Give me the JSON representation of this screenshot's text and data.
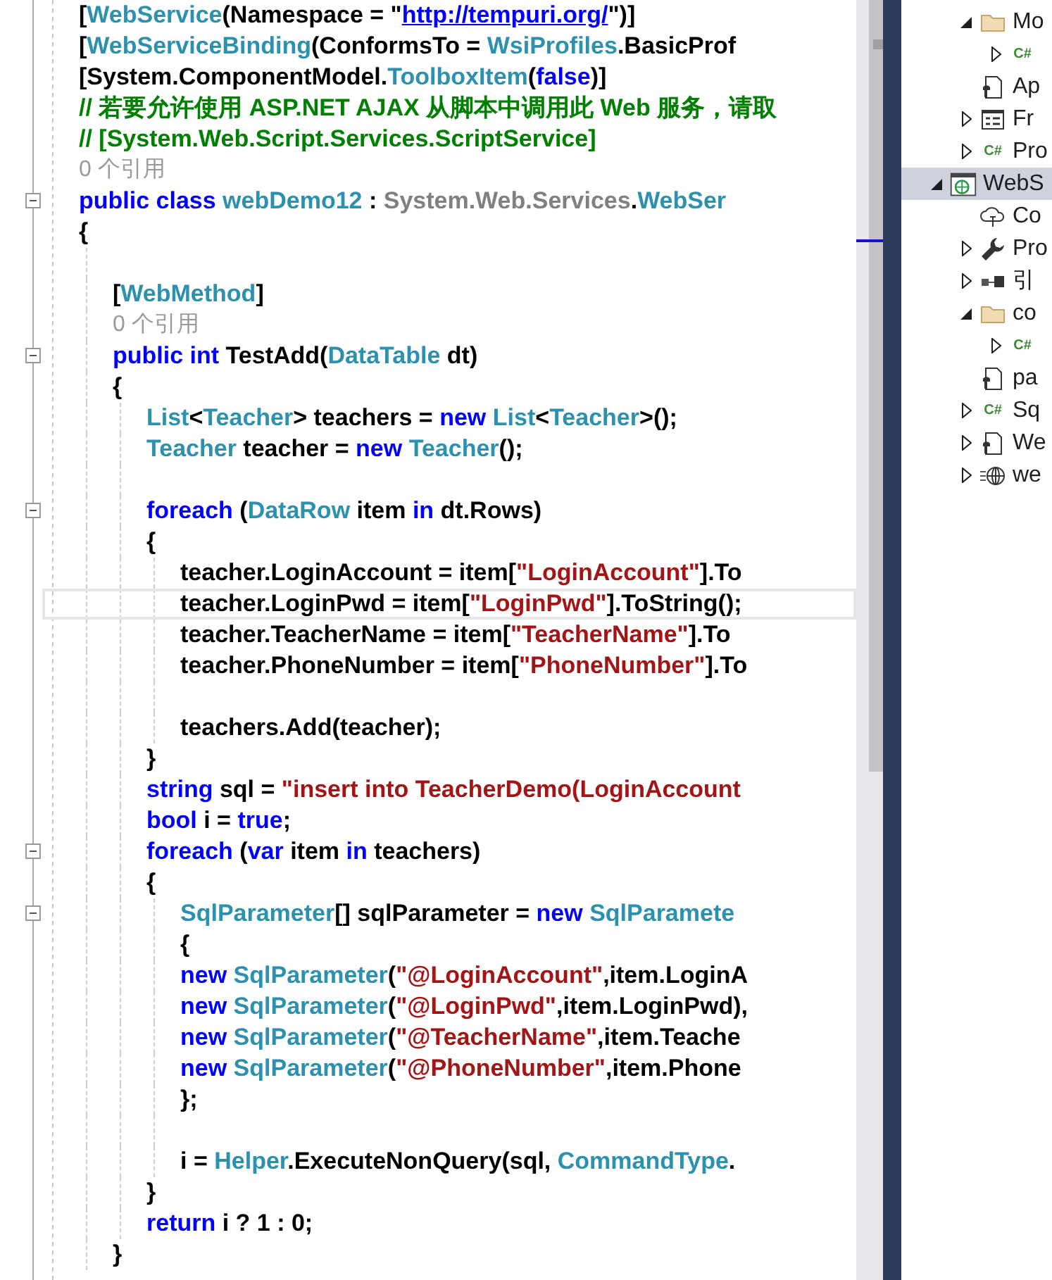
{
  "editor": {
    "lines": [
      {
        "kind": "code",
        "tokens": [
          {
            "kind": "plain",
            "text": "["
          },
          {
            "kind": "type",
            "text": "WebService"
          },
          {
            "kind": "plain",
            "text": "(Namespace = \""
          },
          {
            "kind": "link",
            "text": "http://tempuri.org/"
          },
          {
            "kind": "plain",
            "text": "\")]"
          }
        ]
      },
      {
        "kind": "code",
        "tokens": [
          {
            "kind": "plain",
            "text": "["
          },
          {
            "kind": "type",
            "text": "WebServiceBinding"
          },
          {
            "kind": "plain",
            "text": "(ConformsTo = "
          },
          {
            "kind": "type",
            "text": "WsiProfiles"
          },
          {
            "kind": "plain",
            "text": ".BasicProf"
          }
        ]
      },
      {
        "kind": "code",
        "tokens": [
          {
            "kind": "plain",
            "text": "[System.ComponentModel."
          },
          {
            "kind": "type",
            "text": "ToolboxItem"
          },
          {
            "kind": "plain",
            "text": "("
          },
          {
            "kind": "keyword",
            "text": "false"
          },
          {
            "kind": "plain",
            "text": ")]"
          }
        ]
      },
      {
        "kind": "code",
        "tokens": [
          {
            "kind": "comment",
            "text": "// 若要允许使用 ASP.NET AJAX 从脚本中调用此 Web 服务，请取"
          }
        ]
      },
      {
        "kind": "code",
        "tokens": [
          {
            "kind": "comment",
            "text": "// [System.Web.Script.Services.ScriptService]"
          }
        ]
      },
      {
        "kind": "codelens",
        "text": "0 个引用"
      },
      {
        "kind": "code",
        "expanded": true,
        "tokens": [
          {
            "kind": "keyword",
            "text": "public class "
          },
          {
            "kind": "type",
            "text": "webDemo12"
          },
          {
            "kind": "plain",
            "text": " : "
          },
          {
            "kind": "muted",
            "text": "System.Web.Services"
          },
          {
            "kind": "plain",
            "text": "."
          },
          {
            "kind": "type",
            "text": "WebSer"
          }
        ]
      },
      {
        "kind": "code",
        "tokens": [
          {
            "kind": "plain",
            "text": "{"
          }
        ]
      },
      {
        "children": [
          {
            "kind": "blank"
          },
          {
            "kind": "code",
            "tokens": [
              {
                "kind": "plain",
                "text": "["
              },
              {
                "kind": "type",
                "text": "WebMethod"
              },
              {
                "kind": "plain",
                "text": "]"
              }
            ]
          },
          {
            "kind": "codelens",
            "text": "0 个引用"
          },
          {
            "kind": "code",
            "expanded": true,
            "tokens": [
              {
                "kind": "keyword",
                "text": "public int "
              },
              {
                "kind": "plain",
                "text": "TestAdd("
              },
              {
                "kind": "type",
                "text": "DataTable"
              },
              {
                "kind": "plain",
                "text": " dt)"
              }
            ]
          },
          {
            "kind": "code",
            "tokens": [
              {
                "kind": "plain",
                "text": "{"
              }
            ]
          },
          {
            "children": [
              {
                "kind": "code",
                "tokens": [
                  {
                    "kind": "type",
                    "text": "List"
                  },
                  {
                    "kind": "plain",
                    "text": "<"
                  },
                  {
                    "kind": "type",
                    "text": "Teacher"
                  },
                  {
                    "kind": "plain",
                    "text": "> teachers = "
                  },
                  {
                    "kind": "keyword",
                    "text": "new "
                  },
                  {
                    "kind": "type",
                    "text": "List"
                  },
                  {
                    "kind": "plain",
                    "text": "<"
                  },
                  {
                    "kind": "type",
                    "text": "Teacher"
                  },
                  {
                    "kind": "plain",
                    "text": ">();"
                  }
                ]
              },
              {
                "kind": "code",
                "tokens": [
                  {
                    "kind": "type",
                    "text": "Teacher"
                  },
                  {
                    "kind": "plain",
                    "text": " teacher = "
                  },
                  {
                    "kind": "keyword",
                    "text": "new "
                  },
                  {
                    "kind": "type",
                    "text": "Teacher"
                  },
                  {
                    "kind": "plain",
                    "text": "();"
                  }
                ]
              },
              {
                "kind": "blank"
              },
              {
                "kind": "code",
                "expanded": true,
                "tokens": [
                  {
                    "kind": "keyword",
                    "text": "foreach"
                  },
                  {
                    "kind": "plain",
                    "text": " ("
                  },
                  {
                    "kind": "type",
                    "text": "DataRow"
                  },
                  {
                    "kind": "plain",
                    "text": " item "
                  },
                  {
                    "kind": "keyword",
                    "text": "in"
                  },
                  {
                    "kind": "plain",
                    "text": " dt.Rows)"
                  }
                ]
              },
              {
                "kind": "code",
                "tokens": [
                  {
                    "kind": "plain",
                    "text": "{"
                  }
                ]
              },
              {
                "children": [
                  {
                    "kind": "code",
                    "tokens": [
                      {
                        "kind": "plain",
                        "text": "teacher.LoginAccount = item["
                      },
                      {
                        "kind": "string",
                        "text": "\"LoginAccount\""
                      },
                      {
                        "kind": "plain",
                        "text": "].To"
                      }
                    ]
                  },
                  {
                    "kind": "code",
                    "current": true,
                    "tokens": [
                      {
                        "kind": "plain",
                        "text": "teacher.LoginPwd = item["
                      },
                      {
                        "kind": "string",
                        "text": "\"LoginPwd\""
                      },
                      {
                        "kind": "plain",
                        "text": "].ToString();"
                      }
                    ]
                  },
                  {
                    "kind": "code",
                    "tokens": [
                      {
                        "kind": "plain",
                        "text": "teacher.TeacherName = item["
                      },
                      {
                        "kind": "string",
                        "text": "\"TeacherName\""
                      },
                      {
                        "kind": "plain",
                        "text": "].To"
                      }
                    ]
                  },
                  {
                    "kind": "code",
                    "tokens": [
                      {
                        "kind": "plain",
                        "text": "teacher.PhoneNumber = item["
                      },
                      {
                        "kind": "string",
                        "text": "\"PhoneNumber\""
                      },
                      {
                        "kind": "plain",
                        "text": "].To"
                      }
                    ]
                  },
                  {
                    "kind": "blank"
                  },
                  {
                    "kind": "code",
                    "tokens": [
                      {
                        "kind": "plain",
                        "text": "teachers.Add(teacher);"
                      }
                    ]
                  }
                ]
              },
              {
                "kind": "code",
                "tokens": [
                  {
                    "kind": "plain",
                    "text": "}"
                  }
                ]
              },
              {
                "kind": "code",
                "tokens": [
                  {
                    "kind": "keyword",
                    "text": "string"
                  },
                  {
                    "kind": "plain",
                    "text": " sql = "
                  },
                  {
                    "kind": "string",
                    "text": "\"insert into TeacherDemo(LoginAccount"
                  }
                ]
              },
              {
                "kind": "code",
                "tokens": [
                  {
                    "kind": "keyword",
                    "text": "bool"
                  },
                  {
                    "kind": "plain",
                    "text": " i = "
                  },
                  {
                    "kind": "keyword",
                    "text": "true"
                  },
                  {
                    "kind": "plain",
                    "text": ";"
                  }
                ]
              },
              {
                "kind": "code",
                "expanded": true,
                "tokens": [
                  {
                    "kind": "keyword",
                    "text": "foreach"
                  },
                  {
                    "kind": "plain",
                    "text": " ("
                  },
                  {
                    "kind": "keyword",
                    "text": "var"
                  },
                  {
                    "kind": "plain",
                    "text": " item "
                  },
                  {
                    "kind": "keyword",
                    "text": "in"
                  },
                  {
                    "kind": "plain",
                    "text": " teachers)"
                  }
                ]
              },
              {
                "kind": "code",
                "tokens": [
                  {
                    "kind": "plain",
                    "text": "{"
                  }
                ]
              },
              {
                "children": [
                  {
                    "kind": "code",
                    "expanded": true,
                    "tokens": [
                      {
                        "kind": "type",
                        "text": "SqlParameter"
                      },
                      {
                        "kind": "plain",
                        "text": "[] sqlParameter = "
                      },
                      {
                        "kind": "keyword",
                        "text": "new "
                      },
                      {
                        "kind": "type",
                        "text": "SqlParamete"
                      }
                    ]
                  },
                  {
                    "kind": "code",
                    "tokens": [
                      {
                        "kind": "plain",
                        "text": "{"
                      }
                    ]
                  },
                  {
                    "kind": "code",
                    "tokens": [
                      {
                        "kind": "keyword",
                        "text": "new "
                      },
                      {
                        "kind": "type",
                        "text": "SqlParameter"
                      },
                      {
                        "kind": "plain",
                        "text": "("
                      },
                      {
                        "kind": "string",
                        "text": "\"@LoginAccount\""
                      },
                      {
                        "kind": "plain",
                        "text": ",item.LoginA"
                      }
                    ]
                  },
                  {
                    "kind": "code",
                    "tokens": [
                      {
                        "kind": "keyword",
                        "text": "new "
                      },
                      {
                        "kind": "type",
                        "text": "SqlParameter"
                      },
                      {
                        "kind": "plain",
                        "text": "("
                      },
                      {
                        "kind": "string",
                        "text": "\"@LoginPwd\""
                      },
                      {
                        "kind": "plain",
                        "text": ",item.LoginPwd),"
                      }
                    ]
                  },
                  {
                    "kind": "code",
                    "tokens": [
                      {
                        "kind": "keyword",
                        "text": "new "
                      },
                      {
                        "kind": "type",
                        "text": "SqlParameter"
                      },
                      {
                        "kind": "plain",
                        "text": "("
                      },
                      {
                        "kind": "string",
                        "text": "\"@TeacherName\""
                      },
                      {
                        "kind": "plain",
                        "text": ",item.Teache"
                      }
                    ]
                  },
                  {
                    "kind": "code",
                    "tokens": [
                      {
                        "kind": "keyword",
                        "text": "new "
                      },
                      {
                        "kind": "type",
                        "text": "SqlParameter"
                      },
                      {
                        "kind": "plain",
                        "text": "("
                      },
                      {
                        "kind": "string",
                        "text": "\"@PhoneNumber\""
                      },
                      {
                        "kind": "plain",
                        "text": ",item.Phone"
                      }
                    ]
                  },
                  {
                    "kind": "code",
                    "tokens": [
                      {
                        "kind": "plain",
                        "text": "};"
                      }
                    ]
                  },
                  {
                    "kind": "blank"
                  },
                  {
                    "kind": "code",
                    "tokens": [
                      {
                        "kind": "plain",
                        "text": "i = "
                      },
                      {
                        "kind": "type",
                        "text": "Helper"
                      },
                      {
                        "kind": "plain",
                        "text": ".ExecuteNonQuery(sql, "
                      },
                      {
                        "kind": "type",
                        "text": "CommandType"
                      },
                      {
                        "kind": "plain",
                        "text": "."
                      }
                    ]
                  }
                ]
              },
              {
                "kind": "code",
                "tokens": [
                  {
                    "kind": "plain",
                    "text": "}"
                  }
                ]
              },
              {
                "kind": "code",
                "tokens": [
                  {
                    "kind": "keyword",
                    "text": "return"
                  },
                  {
                    "kind": "plain",
                    "text": " i ? 1 : 0;"
                  }
                ]
              }
            ]
          },
          {
            "kind": "code",
            "tokens": [
              {
                "kind": "plain",
                "text": "}"
              }
            ]
          }
        ]
      }
    ]
  },
  "solution_explorer": {
    "items": [
      {
        "kind": "continuation",
        "children": [
          {
            "kind": "folder",
            "label": "Mo",
            "expanded": true,
            "selected": false,
            "children": [
              {
                "kind": "csharp",
                "icon_text": "C#",
                "expanded": false,
                "selected": false
              }
            ]
          },
          {
            "kind": "config",
            "label": "Ap",
            "selected": false
          },
          {
            "kind": "form",
            "label": "Fr",
            "expanded": false,
            "selected": false
          },
          {
            "kind": "csharp",
            "label": "Pro",
            "icon_text": "C#",
            "expanded": false,
            "selected": false
          }
        ]
      },
      {
        "kind": "web-project",
        "label": "WebS",
        "expanded": true,
        "selected": true,
        "children": [
          {
            "kind": "cloud",
            "label": "Co",
            "selected": false
          },
          {
            "kind": "wrench",
            "label": "Pro",
            "expanded": false,
            "selected": false
          },
          {
            "kind": "references",
            "label": "引",
            "expanded": false,
            "selected": false
          },
          {
            "kind": "folder",
            "label": "co",
            "expanded": true,
            "selected": false,
            "children": [
              {
                "kind": "csharp",
                "icon_text": "C#",
                "expanded": false,
                "selected": false
              }
            ]
          },
          {
            "kind": "config",
            "label": "pa",
            "selected": false
          },
          {
            "kind": "csharp",
            "label": "Sq",
            "icon_text": "C#",
            "expanded": false,
            "selected": false
          },
          {
            "kind": "config",
            "label": "We",
            "expanded": false,
            "selected": false
          },
          {
            "kind": "web-reference",
            "label": "we",
            "expanded": false,
            "selected": false
          }
        ]
      }
    ]
  }
}
